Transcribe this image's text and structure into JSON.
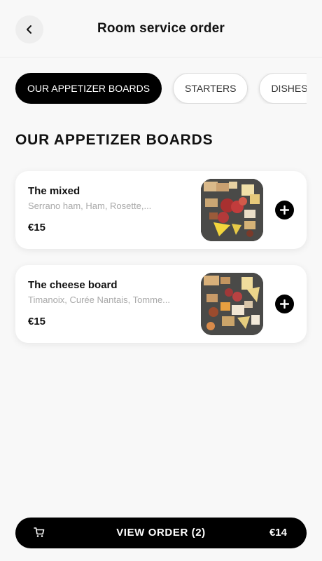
{
  "header": {
    "title": "Room service order",
    "back_icon": "chevron-left-icon"
  },
  "tabs": [
    {
      "label": "OUR APPETIZER BOARDS",
      "active": true
    },
    {
      "label": "STARTERS",
      "active": false
    },
    {
      "label": "DISHES",
      "active": false
    }
  ],
  "section": {
    "title": "OUR APPETIZER BOARDS"
  },
  "items": [
    {
      "name": "The mixed",
      "description": "Serrano ham, Ham, Rosette,...",
      "price": "€15",
      "image_icon": "charcuterie-board-image",
      "add_icon": "plus-icon"
    },
    {
      "name": "The cheese board",
      "description": "Timanoix, Curée Nantais, Tomme...",
      "price": "€15",
      "image_icon": "cheese-board-image",
      "add_icon": "plus-icon"
    }
  ],
  "order_bar": {
    "cart_icon": "cart-icon",
    "label": "VIEW ORDER (2)",
    "total": "€14"
  },
  "colors": {
    "background": "#f8f8f8",
    "accent": "#000000",
    "card": "#ffffff",
    "muted_text": "#a8a8a8"
  }
}
